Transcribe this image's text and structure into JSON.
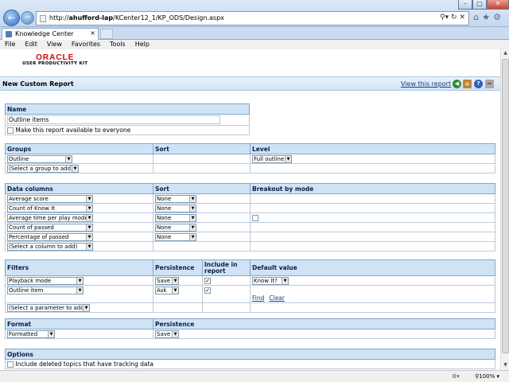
{
  "browser": {
    "address_host": "ahufford-lap",
    "address_path": "/KCenter12_1/KP_ODS/Design.aspx",
    "address_prefix": "http://",
    "tab_title": "Knowledge Center",
    "menu": [
      "File",
      "Edit",
      "View",
      "Favorites",
      "Tools",
      "Help"
    ],
    "zoom": "100%"
  },
  "logo": {
    "brand": "ORACLE",
    "sub": "USER PRODUCTIVITY KIT"
  },
  "header": {
    "title": "New Custom Report",
    "view_link": "View this report"
  },
  "name_section": {
    "header": "Name",
    "value": "Outline items",
    "available_label": "Make this report available to everyone"
  },
  "groups": {
    "headers": [
      "Groups",
      "Sort",
      "Level"
    ],
    "rows": [
      {
        "group": "Outline",
        "level": "Full outline"
      }
    ],
    "add": "(Select a group to add)"
  },
  "data_columns": {
    "headers": [
      "Data columns",
      "Sort",
      "Breakout by mode"
    ],
    "rows": [
      {
        "col": "Average score",
        "sort": "None"
      },
      {
        "col": "Count of Know It",
        "sort": "None"
      },
      {
        "col": "Average time per play mode",
        "sort": "None"
      },
      {
        "col": "Count of passed",
        "sort": "None"
      },
      {
        "col": "Percentage of passed",
        "sort": "None"
      }
    ],
    "add": "(Select a column to add)"
  },
  "filters": {
    "headers": [
      "Filters",
      "Persistence",
      "Include in report",
      "Default value"
    ],
    "rows": [
      {
        "filter": "Playback mode",
        "persistence": "Save",
        "default": "Know It?"
      },
      {
        "filter": "Outline item",
        "persistence": "Ask"
      }
    ],
    "find": "Find",
    "clear": "Clear",
    "add": "(Select a parameter to add)"
  },
  "format": {
    "headers": [
      "Format",
      "Persistence"
    ],
    "format": "Formatted",
    "persistence": "Save"
  },
  "options": {
    "header": "Options",
    "include_deleted": "Include deleted topics that have tracking data"
  }
}
